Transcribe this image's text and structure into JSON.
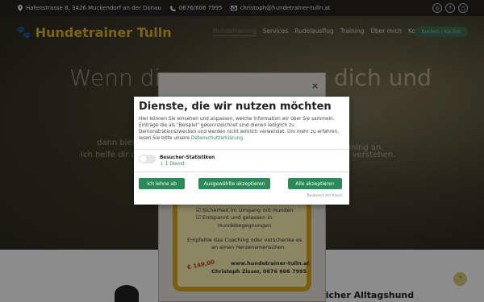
{
  "topbar": {
    "address": "Hafenstrasse 8, 3426 Muckendorf an der Donau",
    "phone": "0676/606 7995",
    "email": "christoph@hundetrainer-tulln.at",
    "social": [
      "whatsapp-icon",
      "facebook-icon",
      "instagram-icon"
    ]
  },
  "brand": {
    "name": "Hundetrainer Tulln",
    "color": "#e6b422"
  },
  "nav": {
    "items": [
      "Hundetraining",
      "Services",
      "Rudelausflug",
      "Training",
      "Über mich",
      "Kontakt"
    ],
    "cta": "Buchen / Kaufen"
  },
  "hero": {
    "title_left": "Wenn die",
    "title_right": "dich und",
    "line1_right": "raining an.",
    "line2_left": "dann biet",
    "line3_left": "Ich helfe dir d",
    "line3_right": "zu verstehen."
  },
  "flyer": {
    "close": "×",
    "bullet1": "☑ Sicherheit im Umgang mit Hunden",
    "bullet2": "☑ Entspannt und gelassen in",
    "bullet2b": "Hundebegegnungen",
    "para1": "Empfehle das Coaching oder verschenke es",
    "para2": "an einen Herzensmenschen.",
    "price": "€ 149,00",
    "website": "www.hundetrainer-tulln.at",
    "contact": "Christoph Zisser, 0676 606 7995"
  },
  "bottom": {
    "title": "licher Alltagshund"
  },
  "consent": {
    "title": "Dienste, die wir nutzen möchten",
    "text": "Hier können Sie einsehen und anpassen, welche Information wir über Sie sammeln. Einträge die als \"Beispiel\" gekennzeichnet sind dienen lediglich zu Demonstrationszwecken und werden nicht wirklich verwendet. Um mehr zu erfahren, lesen Sie bitte unsere ",
    "privacy_link": "Datenschutzerklärung",
    "text_end": ".",
    "service_name": "Besucher-Statistiken",
    "service_count": "↓ 1 Dienst",
    "decline": "Ich lehne ab",
    "accept_selected": "Ausgewählte akzeptieren",
    "accept_all": "Alle akzeptieren",
    "realized": "Realisiert mit Klaro!",
    "accent": "#2c8a5a"
  }
}
